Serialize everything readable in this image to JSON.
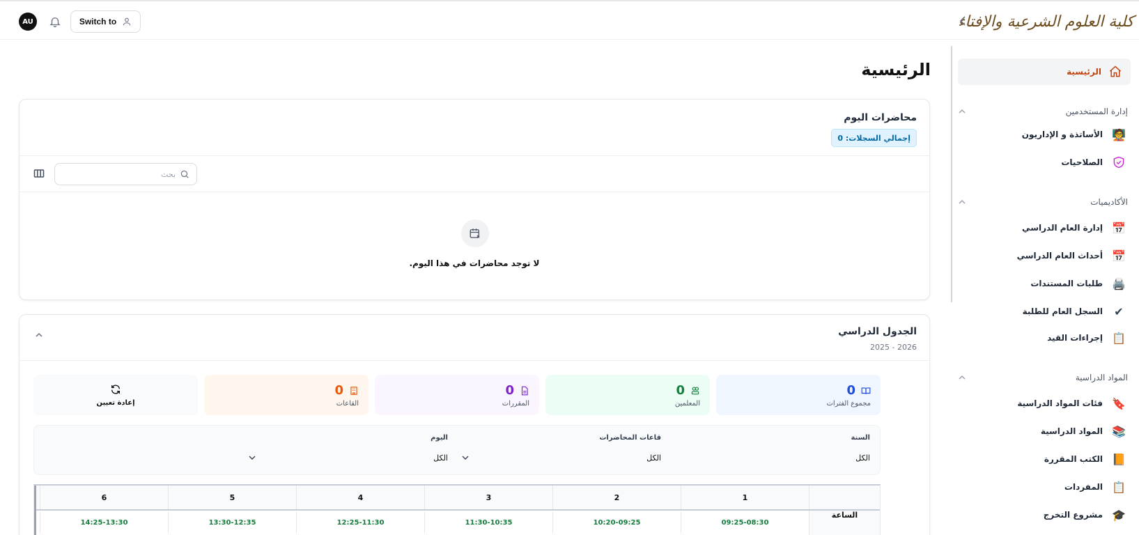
{
  "header": {
    "avatar_initials": "AU",
    "switch_label": "Switch to",
    "logo_text": "كلية العلوم الشرعية والإفتاء"
  },
  "sidebar": {
    "home": "الرئيسية",
    "groups": [
      {
        "label": "إدارة المستخدمين",
        "items": [
          "الأساتذة و الإداريون",
          "الصلاحيات"
        ]
      },
      {
        "label": "الأكاديميات",
        "items": [
          "إدارة العام الدراسي",
          "أحداث العام الدراسي",
          "طلبات المستندات",
          "السجل العام للطلبة",
          "إجراءات القيد"
        ]
      },
      {
        "label": "المواد الدراسية",
        "items": [
          "فئات المواد الدراسية",
          "المواد الدراسية",
          "الكتب المقررة",
          "المفردات",
          "مشروع التخرج"
        ]
      }
    ]
  },
  "main": {
    "page_title": "الرئيسية",
    "today": {
      "title": "محاضرات اليوم",
      "records_label": "إجمالي السجلات: 0",
      "search_placeholder": "بحث",
      "empty_text": "لا توجد محاضرات في هذا اليوم."
    },
    "schedule": {
      "title": "الجدول الدراسي",
      "year": "2025 - 2026",
      "stats": [
        {
          "value": "0",
          "label": "مجموع الفترات"
        },
        {
          "value": "0",
          "label": "المعلمين"
        },
        {
          "value": "0",
          "label": "المقررات"
        },
        {
          "value": "0",
          "label": "القاعات"
        }
      ],
      "reset_label": "إعادة تعيين",
      "filters": [
        {
          "label": "السنة",
          "value": "الكل"
        },
        {
          "label": "قاعات المحاضرات",
          "value": "الكل"
        },
        {
          "label": "اليوم",
          "value": "الكل"
        }
      ],
      "hour_label": "الساعة",
      "periods": [
        "1",
        "2",
        "3",
        "4",
        "5",
        "6"
      ],
      "times": [
        "09:25-08:30",
        "10:20-09:25",
        "11:30-10:35",
        "12:25-11:30",
        "13:30-12:35",
        "14:25-13:30"
      ]
    }
  },
  "colors": {
    "accent": "#c2410c",
    "blue": "#1d4ed8",
    "green": "#15803d",
    "purple": "#7e22ce",
    "orange": "#ea580c"
  }
}
